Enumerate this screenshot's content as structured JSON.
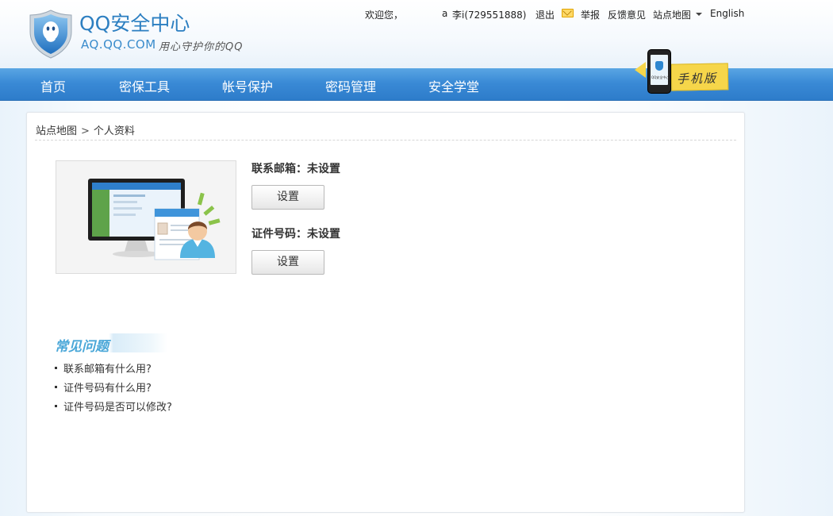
{
  "header": {
    "logo_title": "QQ安全中心",
    "logo_domain": "AQ.QQ.COM",
    "logo_slogan": "用心守护你的QQ"
  },
  "topbar": {
    "welcome": "欢迎您，",
    "user_initial": "a",
    "user_name": "李i(729551888)",
    "logout": "退出",
    "report": "举报",
    "feedback": "反馈意见",
    "sitemap": "站点地图",
    "english": "English"
  },
  "nav": {
    "items": [
      "首页",
      "密保工具",
      "帐号保护",
      "密码管理",
      "安全学堂"
    ]
  },
  "mobile_badge": {
    "label": "手机版",
    "phone_text": "QQ安全中心"
  },
  "breadcrumb": {
    "root": "站点地图",
    "separator": ">",
    "current": "个人资料"
  },
  "profile": {
    "email_label": "联系邮箱：未设置",
    "email_button": "设置",
    "id_label": "证件号码：未设置",
    "id_button": "设置"
  },
  "faq": {
    "title": "常见问题",
    "items": [
      "联系邮箱有什么用?",
      "证件号码有什么用?",
      "证件号码是否可以修改?"
    ]
  },
  "colors": {
    "nav_blue": "#3a8ad6",
    "logo_blue": "#2c7fc1",
    "faq_blue": "#4aa7d8",
    "badge_yellow": "#f6d64a"
  }
}
